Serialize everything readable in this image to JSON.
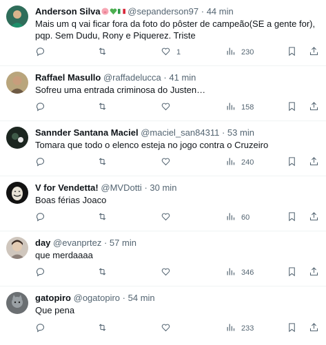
{
  "tweets": [
    {
      "name": "Anderson Silva",
      "name_emoji": [
        "pig-face-icon",
        "green-heart-icon",
        "italy-flag-icon"
      ],
      "handle": "@sepanderson97",
      "time": "44 min",
      "text": "Mais um q vai ficar fora da foto do pôster de campeão(SE a gente for), pqp. Sem Dudu, Rony e Piquerez. Triste",
      "likes": "1",
      "views": "230",
      "avatar_color": "#3a6b5a"
    },
    {
      "name": "Raffael Masullo",
      "handle": "@raffadelucca",
      "time": "41 min",
      "text": "Sofreu uma entrada criminosa do Justen…",
      "likes": "",
      "views": "158",
      "avatar_color": "#8a7a5c"
    },
    {
      "name": "Sannder Santana Maciel",
      "handle": "@maciel_san84311",
      "time": "53 min",
      "text": "Tomara que todo o elenco esteja no jogo contra o Cruzeiro",
      "likes": "",
      "views": "240",
      "avatar_color": "#1e2a22"
    },
    {
      "name": "V for Vendetta!",
      "handle": "@MVDotti",
      "time": "30 min",
      "text": "Boas férias Joaco",
      "likes": "",
      "views": "60",
      "avatar_color": "#151515"
    },
    {
      "name": "day",
      "handle": "@evanprtez",
      "time": "57 min",
      "text": "que merdaaaa",
      "likes": "",
      "views": "346",
      "avatar_color": "#9a8f86"
    },
    {
      "name": "gatopiro",
      "handle": "@ogatopiro",
      "time": "54 min",
      "text": "Que pena",
      "likes": "",
      "views": "233",
      "avatar_color": "#5b5f63"
    }
  ],
  "icons": {
    "reply": "reply-icon",
    "retweet": "retweet-icon",
    "like": "heart-icon",
    "views": "views-icon",
    "bookmark": "bookmark-icon",
    "share": "share-icon"
  },
  "colors": {
    "text": "#0f1419",
    "muted": "#536471",
    "divider": "#eff3f4"
  }
}
